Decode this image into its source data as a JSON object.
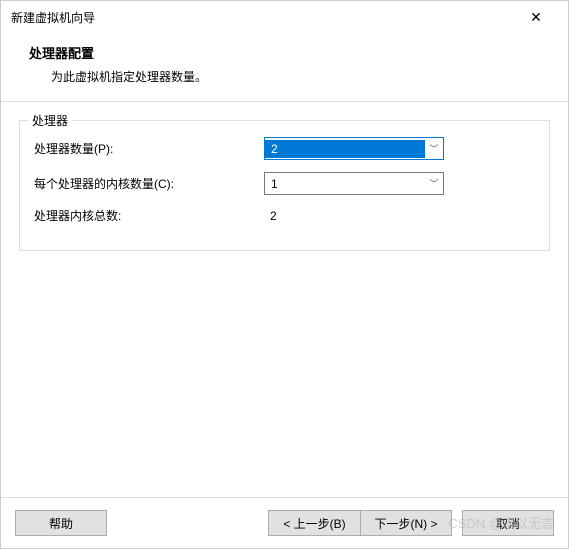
{
  "window": {
    "title": "新建虚拟机向导"
  },
  "header": {
    "title": "处理器配置",
    "subtitle": "为此虚拟机指定处理器数量。"
  },
  "group": {
    "label": "处理器",
    "processors": {
      "label": "处理器数量(P):",
      "value": "2"
    },
    "cores": {
      "label": "每个处理器的内核数量(C):",
      "value": "1"
    },
    "total": {
      "label": "处理器内核总数:",
      "value": "2"
    }
  },
  "footer": {
    "help": "帮助",
    "back": "< 上一步(B)",
    "next": "下一步(N) >",
    "cancel": "取消"
  },
  "watermark": "CSDN @诺以无言"
}
